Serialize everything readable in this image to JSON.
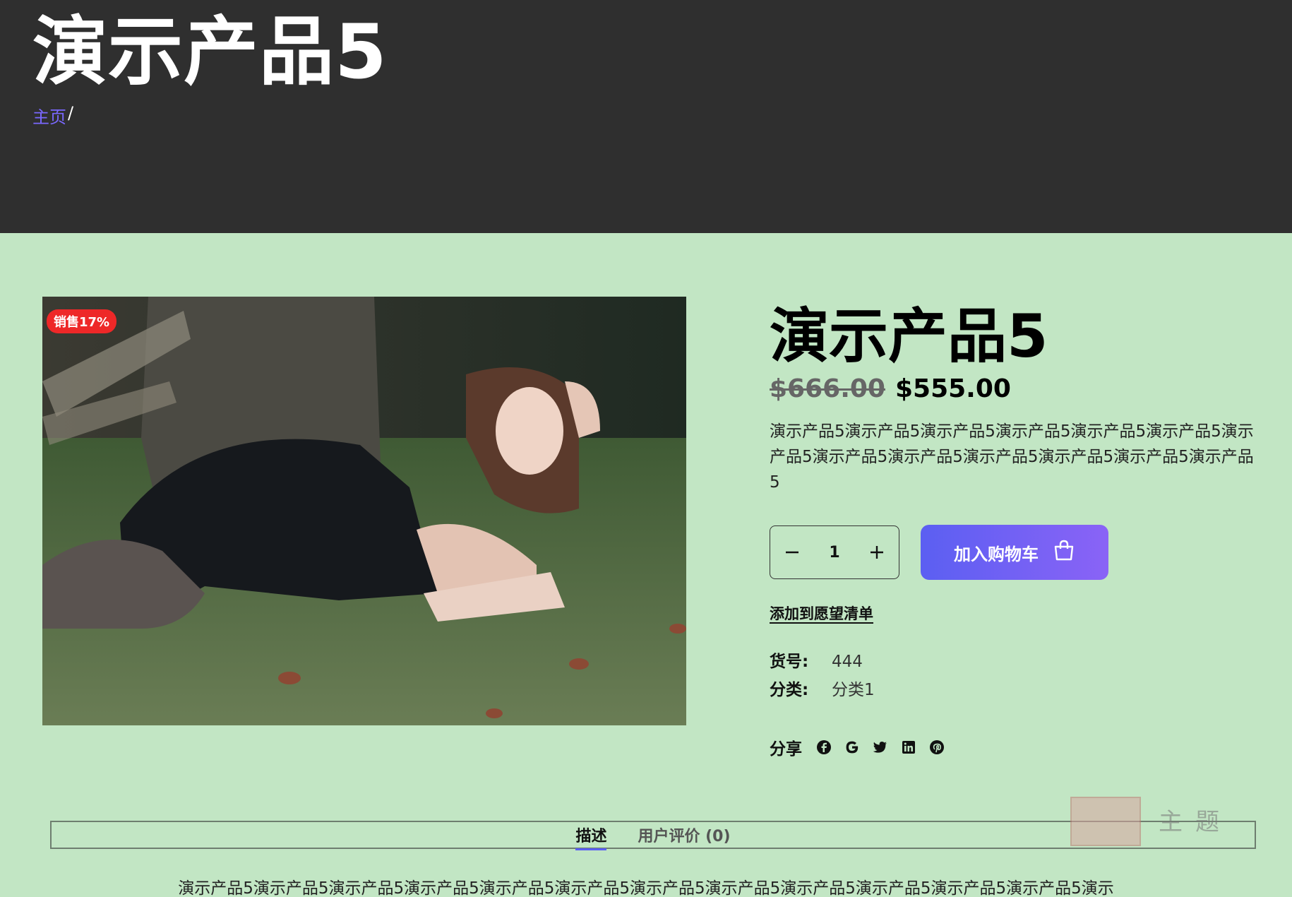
{
  "header": {
    "title": "演示产品5",
    "breadcrumb": {
      "home": "主页",
      "separator": "/"
    }
  },
  "product": {
    "badge": "销售17%",
    "title": "演示产品5",
    "price_old": "$666.00",
    "price_new": "$555.00",
    "short_description": "演示产品5演示产品5演示产品5演示产品5演示产品5演示产品5演示产品5演示产品5演示产品5演示产品5演示产品5演示产品5演示产品5",
    "quantity": "1",
    "add_to_cart": "加入购物车",
    "wishlist": "添加到愿望清单",
    "meta": {
      "sku_label": "货号:",
      "sku_value": "444",
      "category_label": "分类:",
      "category_value": "分类1"
    },
    "share_label": "分享",
    "share_icons": [
      "facebook-icon",
      "google-icon",
      "twitter-icon",
      "linkedin-icon",
      "pinterest-icon"
    ]
  },
  "tabs": [
    {
      "label": "描述",
      "active": true
    },
    {
      "label": "用户评价 (0)",
      "active": false
    }
  ],
  "description_text": "演示产品5演示产品5演示产品5演示产品5演示产品5演示产品5演示产品5演示产品5演示产品5演示产品5演示产品5演示产品5演示",
  "watermark": {
    "text": "主题"
  },
  "colors": {
    "page_bg": "#c2e6c4",
    "hero_bg": "#2f2f2f",
    "link": "#7a68ff",
    "sale_badge": "#ee2828",
    "cart_gradient_start": "#5b5ff2",
    "cart_gradient_end": "#8a63f6"
  }
}
